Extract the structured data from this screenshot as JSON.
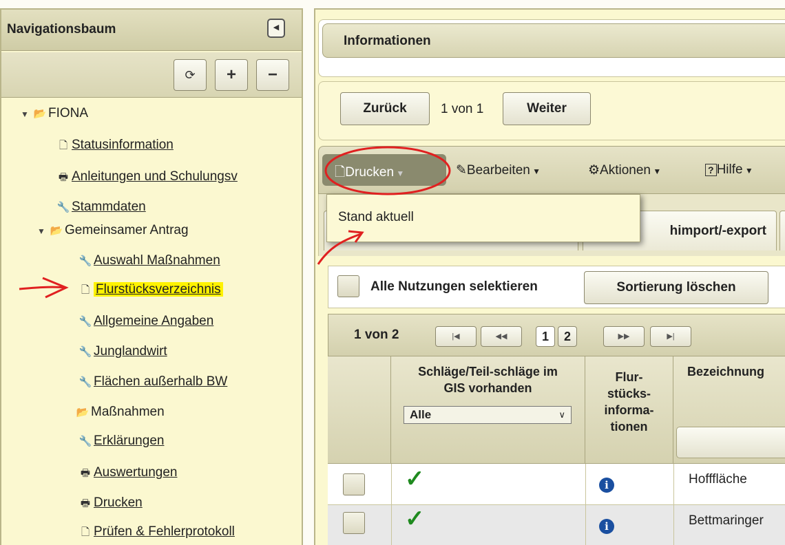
{
  "nav": {
    "title": "Navigationsbaum",
    "tools": {
      "refresh": "⟳",
      "expand": "+",
      "collapse": "−"
    },
    "items": [
      {
        "label": "FIONA",
        "icon": "folder-open-icon",
        "level": 0,
        "expanded": true
      },
      {
        "label": "Statusinformation",
        "icon": "document-icon",
        "level": 1
      },
      {
        "label": "Anleitungen und Schulungsv",
        "icon": "printer-icon",
        "level": 1
      },
      {
        "label": "Stammdaten",
        "icon": "wrench-icon",
        "level": 1
      },
      {
        "label": "Gemeinsamer Antrag",
        "icon": "folder-open-icon",
        "level": 1,
        "expanded": true
      },
      {
        "label": "Auswahl Maßnahmen",
        "icon": "wrench-icon",
        "level": 2
      },
      {
        "label": "Flurstücksverzeichnis",
        "icon": "document-icon",
        "level": 2,
        "highlighted": true
      },
      {
        "label": "Allgemeine Angaben",
        "icon": "wrench-icon",
        "level": 2
      },
      {
        "label": "Junglandwirt",
        "icon": "wrench-icon",
        "level": 2
      },
      {
        "label": "Flächen außerhalb BW",
        "icon": "wrench-icon",
        "level": 2
      },
      {
        "label": "Maßnahmen",
        "icon": "folder-open-icon",
        "level": 2
      },
      {
        "label": "Erklärungen",
        "icon": "wrench-icon",
        "level": 2
      },
      {
        "label": "Auswertungen",
        "icon": "printer-icon",
        "level": 2
      },
      {
        "label": "Drucken",
        "icon": "printer-icon",
        "level": 2
      },
      {
        "label": "Prüfen & Fehlerprotokoll",
        "icon": "document-icon",
        "level": 2
      }
    ]
  },
  "info": {
    "title": "Informationen"
  },
  "pager": {
    "back": "Zurück",
    "position": "1 von 1",
    "next": "Weiter"
  },
  "toolbar": {
    "print": "Drucken",
    "edit": "Bearbeiten",
    "actions": "Aktionen",
    "help": "Hilfe"
  },
  "print_menu": {
    "items": [
      "Stand aktuell"
    ]
  },
  "tabs": {
    "partial": "himport/-export"
  },
  "selection": {
    "select_all": "Alle Nutzungen selektieren",
    "clear_sort": "Sortierung löschen"
  },
  "grid_pager": {
    "position": "1 von 2",
    "pages": [
      "1",
      "2"
    ],
    "current_page": "1"
  },
  "table": {
    "headers": {
      "gis": "Schläge/Teil-schläge im GIS vorhanden",
      "flur": "Flur-stücks-informa-tionen",
      "name": "Bezeichnung"
    },
    "gis_filter": "Alle",
    "rows": [
      {
        "gis": "✓",
        "name": "Hofffläche"
      },
      {
        "gis": "✓",
        "name": "Bettmaringer"
      }
    ]
  },
  "colors": {
    "panel": "#fbf8d0",
    "header": "#d7d4b2",
    "highlight": "#fff200",
    "annotation": "#e02020"
  }
}
